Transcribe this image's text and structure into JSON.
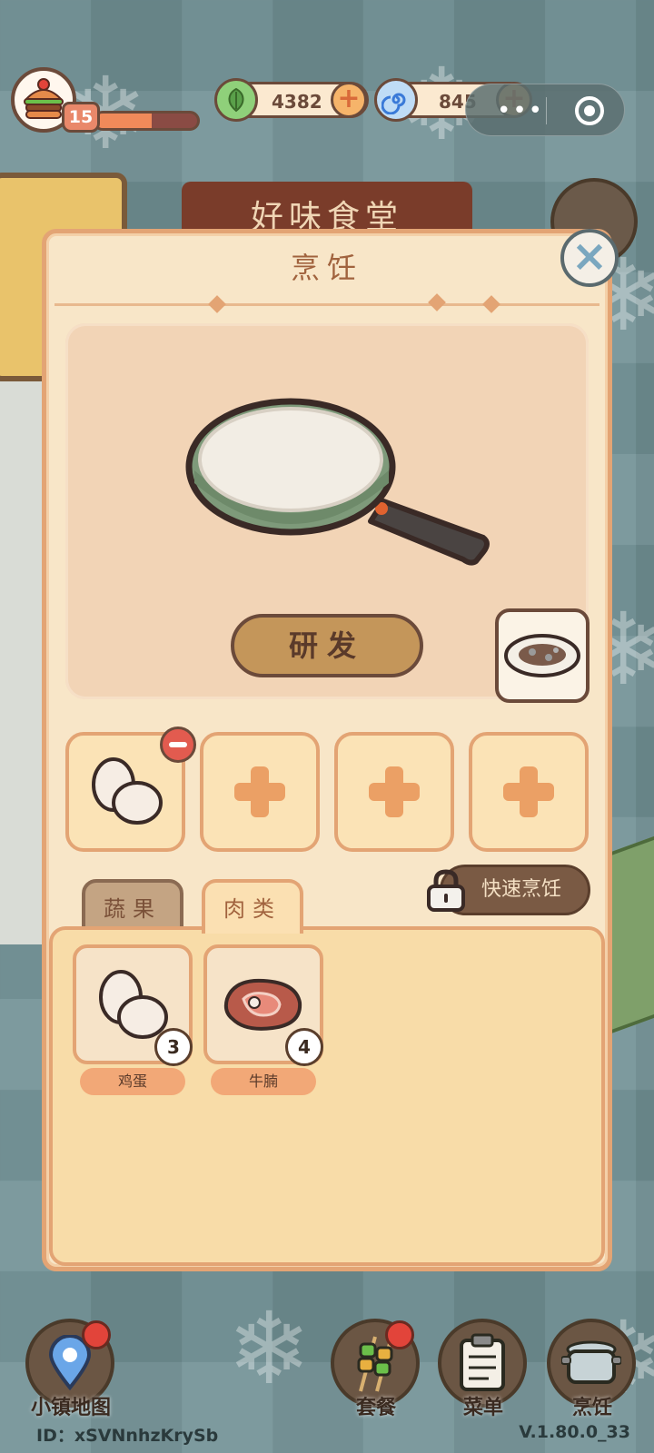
{
  "hud": {
    "level": "15",
    "xp_progress_percent": 55,
    "currencies": [
      {
        "name": "leaf",
        "value": "4382",
        "icon": "leaf-icon",
        "color": "#8fd07a"
      },
      {
        "name": "spiral",
        "value": "845",
        "icon": "swirl-icon",
        "color": "#6aa6e8"
      }
    ]
  },
  "background": {
    "sign_text": "好味食堂"
  },
  "panel": {
    "title": "烹饪",
    "research_button": "研发",
    "quick_cook_button": "快速烹饪",
    "ingredient_slots": [
      {
        "filled": true,
        "item": "egg-icon"
      },
      {
        "filled": false
      },
      {
        "filled": false
      },
      {
        "filled": false
      }
    ],
    "tabs": [
      {
        "label": "蔬果",
        "active": false
      },
      {
        "label": "肉类",
        "active": true
      }
    ],
    "inventory": [
      {
        "name": "鸡蛋",
        "count": "3",
        "icon": "egg-icon"
      },
      {
        "name": "牛腩",
        "count": "4",
        "icon": "steak-icon"
      }
    ]
  },
  "bottom_nav": [
    {
      "label": "小镇地图",
      "icon": "map-pin-icon",
      "badge": true
    },
    {
      "label": "套餐",
      "icon": "skewer-icon",
      "badge": true
    },
    {
      "label": "菜单",
      "icon": "clipboard-icon",
      "badge": false
    },
    {
      "label": "烹饪",
      "icon": "pot-icon",
      "badge": false
    }
  ],
  "footer": {
    "id_text": "ID：xSVNnhzKrySb",
    "version": "V.1.80.0_33"
  },
  "colors": {
    "panel_bg": "#f8e6c8",
    "panel_border": "#e3a474",
    "accent_brown": "#6b4a3a",
    "badge_red": "#e2443a"
  }
}
